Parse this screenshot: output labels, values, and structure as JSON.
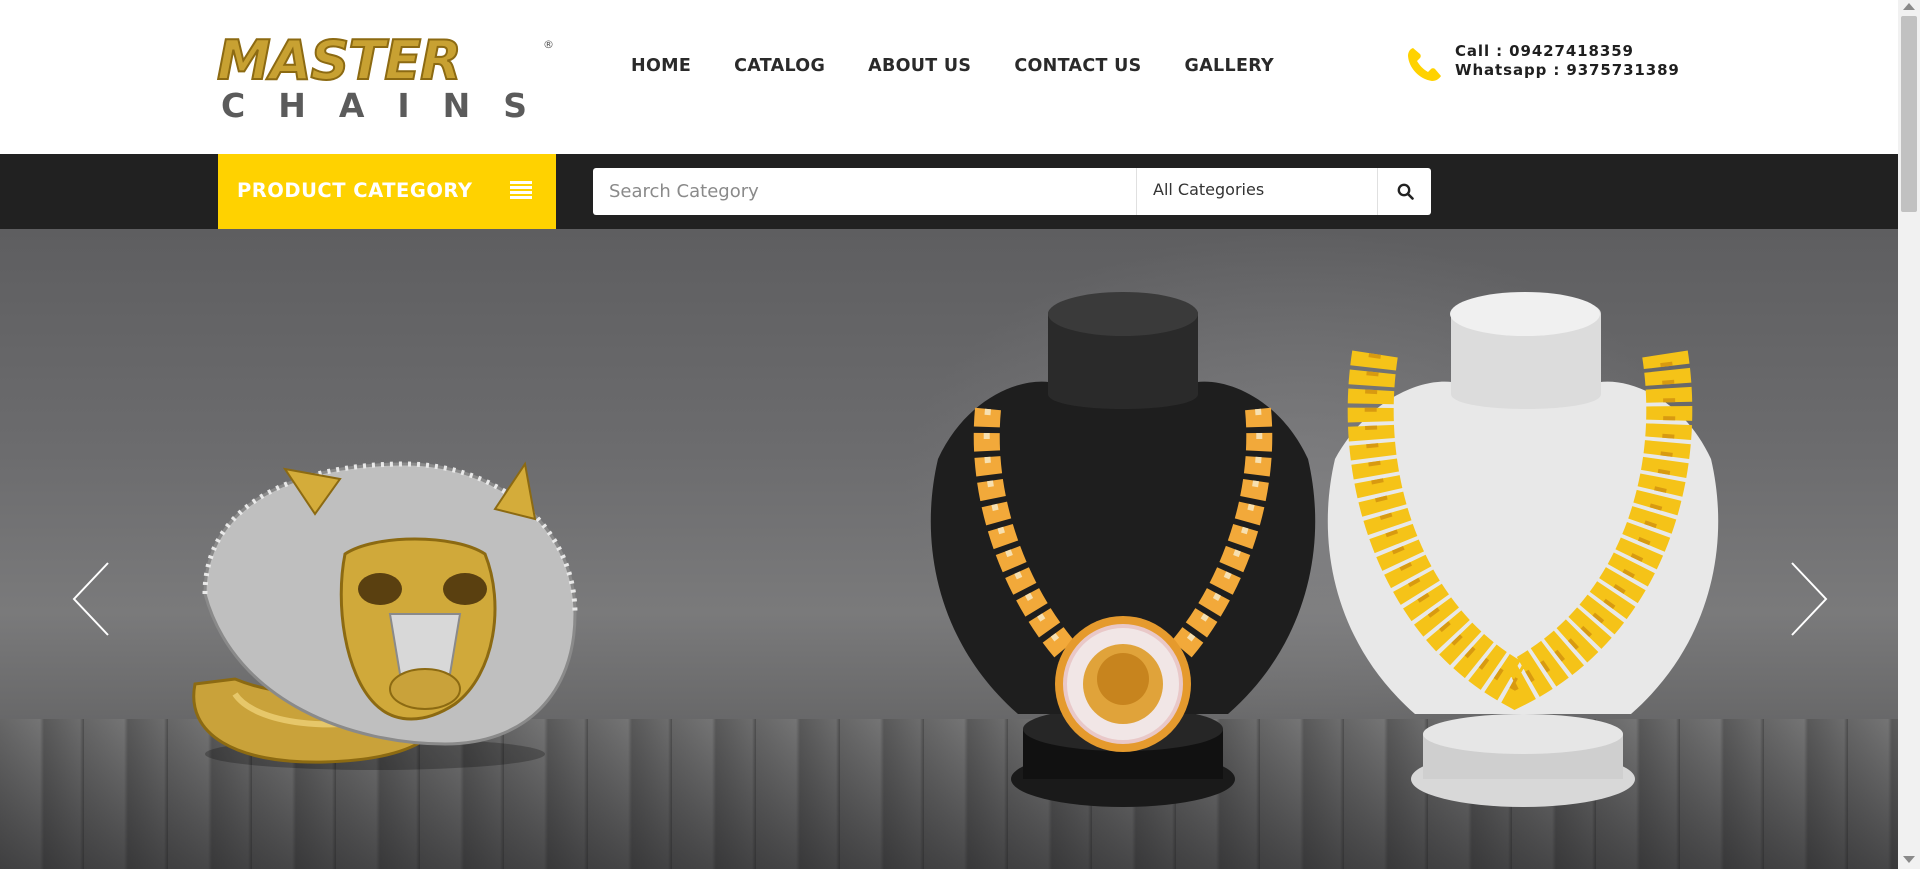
{
  "brand": {
    "logo_top": "MASTER",
    "logo_bottom": "CHAINS",
    "logo_reg": "®",
    "gold": "#c8a132",
    "accent": "#ffd200"
  },
  "nav": {
    "items": [
      {
        "label": "HOME"
      },
      {
        "label": "CATALOG"
      },
      {
        "label": "ABOUT US"
      },
      {
        "label": "CONTACT US"
      },
      {
        "label": "GALLERY"
      }
    ]
  },
  "contact": {
    "icon": "phone-icon",
    "call": "Call : 09427418359",
    "whatsapp": "Whatsapp : 9375731389"
  },
  "topbar": {
    "category_button": "PRODUCT CATEGORY",
    "search_placeholder": "Search Category",
    "search_value": "",
    "category_select": "All Categories",
    "search_icon": "search-icon"
  },
  "hero": {
    "slides": [
      {
        "items": [
          "panther-ring",
          "lion-pendant-chain-on-black-bust",
          "rope-chain-on-white-bust"
        ]
      }
    ],
    "prev_icon": "chevron-left-icon",
    "next_icon": "chevron-right-icon"
  }
}
